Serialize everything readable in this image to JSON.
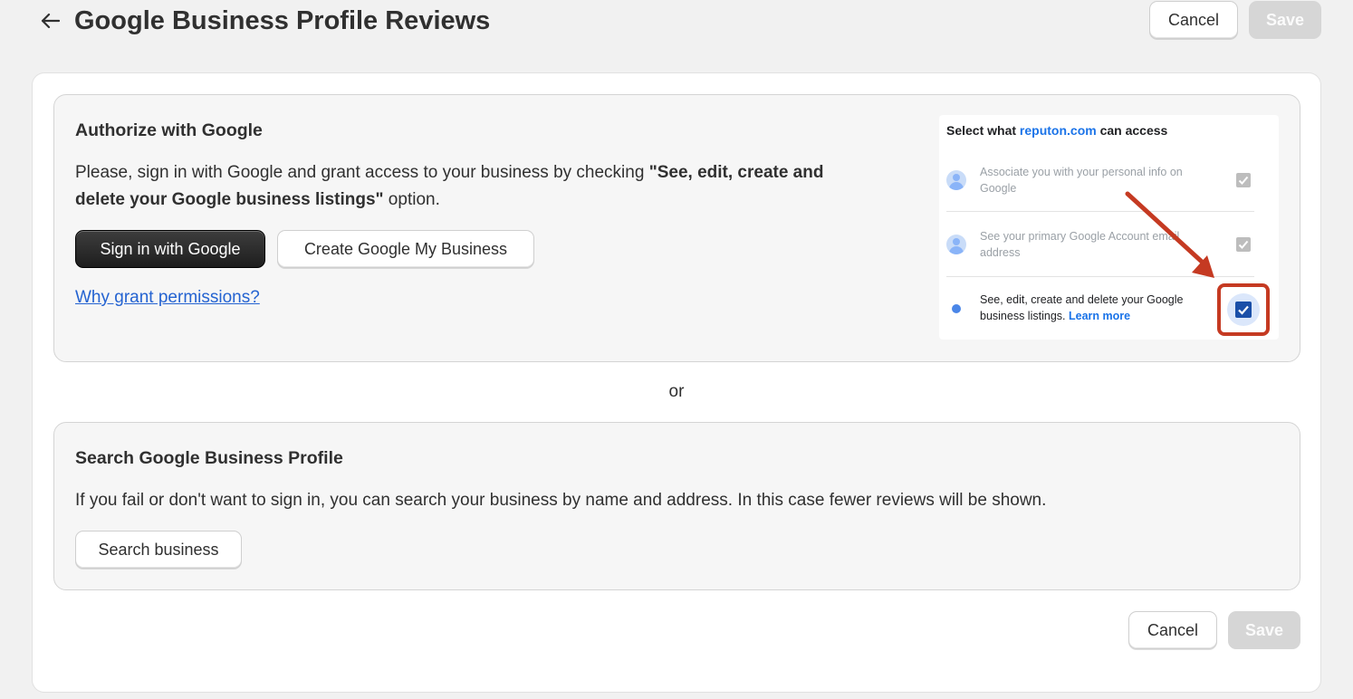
{
  "header": {
    "title": "Google Business Profile Reviews",
    "cancel_label": "Cancel",
    "save_label": "Save"
  },
  "authorize": {
    "heading": "Authorize with Google",
    "description_pre": "Please, sign in with Google and grant access to your business by checking ",
    "description_bold": "\"See, edit, create and delete your Google business listings\"",
    "description_post": " option.",
    "sign_in_label": "Sign in with Google",
    "create_gmb_label": "Create Google My Business",
    "why_link": "Why grant permissions?"
  },
  "consent_preview": {
    "heading_pre": "Select what ",
    "heading_domain": "reputon.com",
    "heading_post": " can access",
    "items": [
      {
        "text": "Associate you with your personal info on Google",
        "checked": true,
        "state": "disabled"
      },
      {
        "text": "See your primary Google Account email address",
        "checked": true,
        "state": "disabled"
      },
      {
        "text": "See, edit, create and delete your Google business listings.",
        "link": "Learn more",
        "checked": true,
        "state": "active"
      }
    ],
    "annotation_color": "#c53a22"
  },
  "separator_text": "or",
  "search": {
    "heading": "Search Google Business Profile",
    "description": "If you fail or don't want to sign in, you can search your business by name and address. In this case fewer reviews will be shown.",
    "search_label": "Search business"
  },
  "footer": {
    "cancel_label": "Cancel",
    "save_label": "Save"
  },
  "colors": {
    "page_bg": "#f1f1f1",
    "link": "#2463d1",
    "primary_button": "#303030",
    "disabled_button": "#d6d6d6",
    "google_blue": "#1a73e8"
  }
}
